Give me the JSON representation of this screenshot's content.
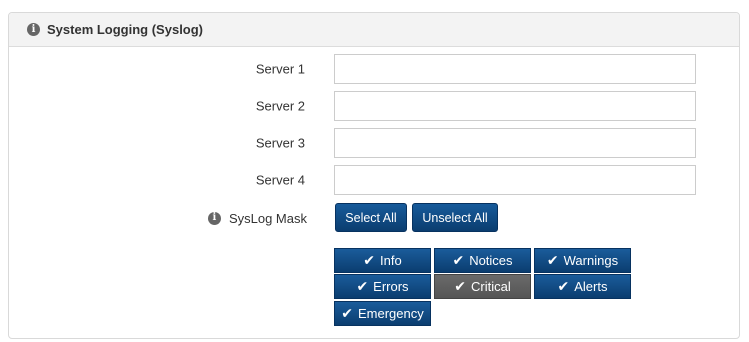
{
  "panel": {
    "title": "System Logging (Syslog)",
    "info_icon": "i"
  },
  "servers": [
    {
      "label": "Server 1",
      "value": ""
    },
    {
      "label": "Server 2",
      "value": ""
    },
    {
      "label": "Server 3",
      "value": ""
    },
    {
      "label": "Server 4",
      "value": ""
    }
  ],
  "mask": {
    "label": "SysLog Mask",
    "info_icon": "i",
    "select_all_label": "Select All",
    "unselect_all_label": "Unselect All",
    "checkmark": "✔",
    "items": [
      {
        "label": "Info",
        "selected": true
      },
      {
        "label": "Notices",
        "selected": true
      },
      {
        "label": "Warnings",
        "selected": true
      },
      {
        "label": "Errors",
        "selected": true
      },
      {
        "label": "Critical",
        "selected": false
      },
      {
        "label": "Alerts",
        "selected": true
      },
      {
        "label": "Emergency",
        "selected": true
      }
    ]
  },
  "colors": {
    "button_blue": "#0b3d6f",
    "toggle_off_gray": "#5f5f5f"
  }
}
